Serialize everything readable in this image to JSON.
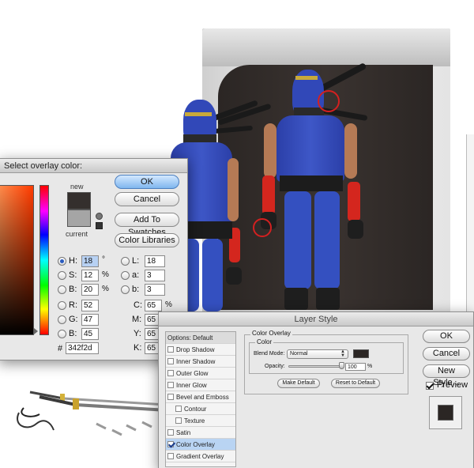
{
  "picker": {
    "title": "Select overlay color:",
    "new_label": "new",
    "current_label": "current",
    "new_color": "#342f2d",
    "current_color": "#a5a5a5",
    "buttons": {
      "ok": "OK",
      "cancel": "Cancel",
      "add_swatches": "Add To Swatches",
      "color_libraries": "Color Libraries"
    },
    "hsb": {
      "h_label": "H:",
      "h_value": "18",
      "h_unit": "°",
      "s_label": "S:",
      "s_value": "12",
      "s_unit": "%",
      "b_label": "B:",
      "b_value": "20",
      "b_unit": "%"
    },
    "rgb": {
      "r_label": "R:",
      "r_value": "52",
      "g_label": "G:",
      "g_value": "47",
      "b_label": "B:",
      "b_value": "45"
    },
    "lab": {
      "l_label": "L:",
      "l_value": "18",
      "a_label": "a:",
      "a_value": "3",
      "b_label": "b:",
      "b_value": "3"
    },
    "cmyk": {
      "c_label": "C:",
      "c_value": "65",
      "c_unit": "%",
      "m_label": "M:",
      "m_value": "65",
      "m_unit": "%",
      "y_label": "Y:",
      "y_value": "65",
      "y_unit": "%",
      "k_label": "K:",
      "k_value": "65",
      "k_unit": "%"
    },
    "hex_label": "#",
    "hex_value": "342f2d"
  },
  "layer_style": {
    "title": "Layer Style",
    "styles": [
      {
        "label": "Options: Default",
        "header": true
      },
      {
        "label": "Drop Shadow",
        "checked": false
      },
      {
        "label": "Inner Shadow",
        "checked": false
      },
      {
        "label": "Outer Glow",
        "checked": false
      },
      {
        "label": "Inner Glow",
        "checked": false
      },
      {
        "label": "Bevel and Emboss",
        "checked": false
      },
      {
        "label": "Contour",
        "checked": false,
        "indent": true
      },
      {
        "label": "Texture",
        "checked": false,
        "indent": true
      },
      {
        "label": "Satin",
        "checked": false
      },
      {
        "label": "Color Overlay",
        "checked": true,
        "selected": true
      },
      {
        "label": "Gradient Overlay",
        "checked": false
      }
    ],
    "section_title": "Color Overlay",
    "group_title": "Color",
    "blend_mode_label": "Blend Mode:",
    "blend_mode_value": "Normal",
    "overlay_color": "#2b2624",
    "opacity_label": "Opacity:",
    "opacity_value": "100",
    "opacity_unit": "%",
    "opacity_fraction": 1.0,
    "make_default": "Make Default",
    "reset_default": "Reset to Default",
    "buttons": {
      "ok": "OK",
      "cancel": "Cancel",
      "new_style": "New Style...",
      "preview": "Preview"
    },
    "preview_checked": true
  }
}
